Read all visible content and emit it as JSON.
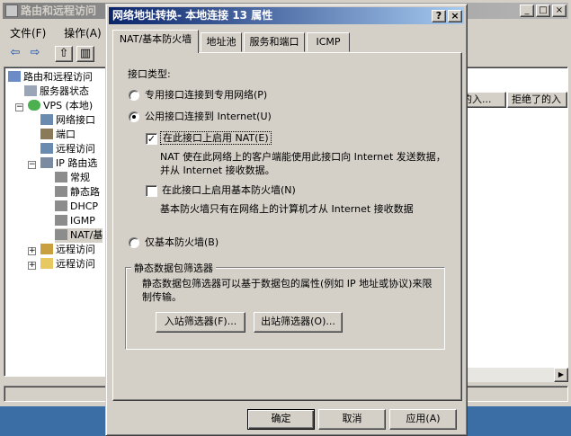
{
  "mmc": {
    "title": "路由和远程访问",
    "menu": [
      "文件(F)",
      "操作(A)"
    ],
    "tree": [
      {
        "label": "路由和远程访问"
      },
      {
        "label": "服务器状态"
      },
      {
        "label": "VPS (本地)"
      },
      {
        "label": "网络接口"
      },
      {
        "label": "端口"
      },
      {
        "label": "远程访问"
      },
      {
        "label": "IP 路由选"
      },
      {
        "label": "常规"
      },
      {
        "label": "静态路"
      },
      {
        "label": "DHCP"
      },
      {
        "label": "IGMP"
      },
      {
        "label": "NAT/基"
      },
      {
        "label": "远程访问"
      },
      {
        "label": "远程访问"
      }
    ],
    "columns": [
      "的入...",
      "拒绝了的入"
    ]
  },
  "dialog": {
    "title": "网络地址转换- 本地连接 13 属性",
    "title_buttons": {
      "help": "?",
      "close": "×"
    },
    "tabs": [
      "NAT/基本防火墙",
      "地址池",
      "服务和端口",
      "ICMP"
    ],
    "interface_type_label": "接口类型:",
    "radio_private": "专用接口连接到专用网络(P)",
    "radio_public": "公用接口连接到 Internet(U)",
    "enable_nat_label": "在此接口上启用 NAT(E)",
    "enable_nat_checked": true,
    "nat_desc": "NAT 使在此网络上的客户端能使用此接口向 Internet 发送数据，并从 Internet 接收数据。",
    "enable_firewall_label": "在此接口上启用基本防火墙(N)",
    "enable_firewall_checked": false,
    "firewall_desc": "基本防火墙只有在网络上的计算机才从 Internet 接收数据",
    "radio_firewall_only": "仅基本防火墙(B)",
    "selected_radio": "public",
    "packet_filters": {
      "legend": "静态数据包筛选器",
      "desc": "静态数据包筛选器可以基于数据包的属性(例如 IP 地址或协议)来限制传输。",
      "inbound_button": "入站筛选器(F)...",
      "outbound_button": "出站筛选器(O)..."
    },
    "buttons": {
      "ok": "确定",
      "cancel": "取消",
      "apply": "应用(A)"
    }
  }
}
